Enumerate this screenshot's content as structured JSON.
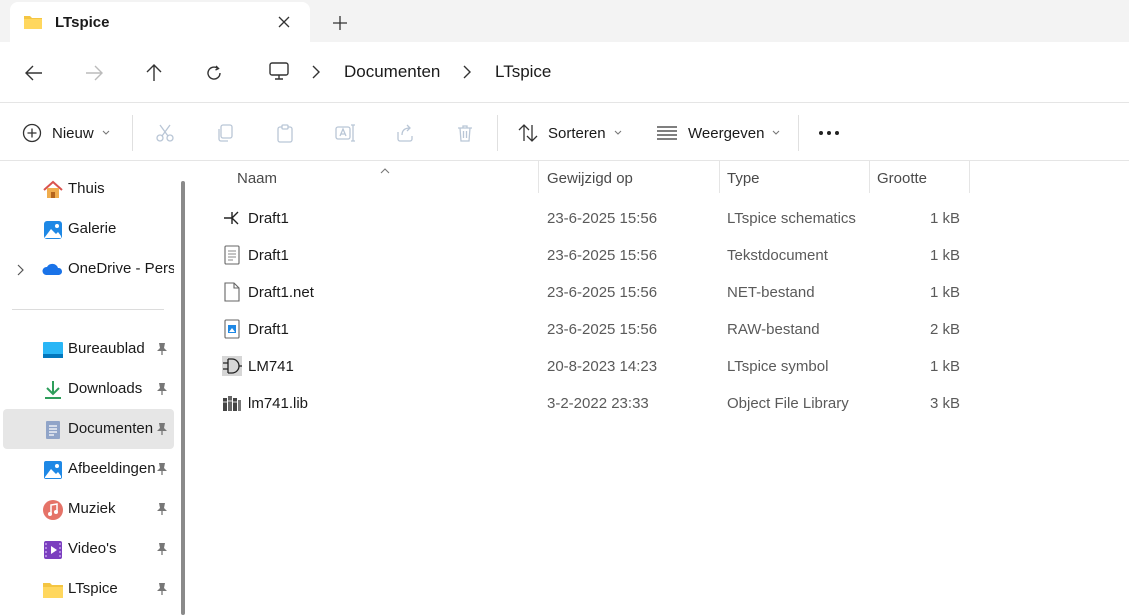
{
  "tab": {
    "title": "LTspice"
  },
  "address": {
    "crumbs": [
      "Documenten",
      "LTspice"
    ]
  },
  "commands": {
    "new_label": "Nieuw",
    "sort_label": "Sorteren",
    "view_label": "Weergeven"
  },
  "sidebar": {
    "items": [
      {
        "label": "Thuis",
        "icon": "home-icon"
      },
      {
        "label": "Galerie",
        "icon": "gallery-icon"
      },
      {
        "label": "OneDrive - Perso",
        "icon": "onedrive-icon"
      },
      {
        "label": "Bureaublad",
        "icon": "desktop-icon",
        "pinned": true
      },
      {
        "label": "Downloads",
        "icon": "download-icon",
        "pinned": true
      },
      {
        "label": "Documenten",
        "icon": "documents-icon",
        "pinned": true,
        "selected": true
      },
      {
        "label": "Afbeeldingen",
        "icon": "pictures-icon",
        "pinned": true
      },
      {
        "label": "Muziek",
        "icon": "music-icon",
        "pinned": true
      },
      {
        "label": "Video's",
        "icon": "videos-icon",
        "pinned": true
      },
      {
        "label": "LTspice",
        "icon": "folder-icon",
        "pinned": true
      }
    ]
  },
  "columns": {
    "name": "Naam",
    "modified": "Gewijzigd op",
    "type": "Type",
    "size": "Grootte"
  },
  "files": [
    {
      "name": "Draft1",
      "modified": "23-6-2025 15:56",
      "type": "LTspice schematics",
      "size": "1 kB",
      "icon": "schematic-icon"
    },
    {
      "name": "Draft1",
      "modified": "23-6-2025 15:56",
      "type": "Tekstdocument",
      "size": "1 kB",
      "icon": "text-document-icon"
    },
    {
      "name": "Draft1.net",
      "modified": "23-6-2025 15:56",
      "type": "NET-bestand",
      "size": "1 kB",
      "icon": "generic-file-icon"
    },
    {
      "name": "Draft1",
      "modified": "23-6-2025 15:56",
      "type": "RAW-bestand",
      "size": "2 kB",
      "icon": "raw-file-icon"
    },
    {
      "name": "LM741",
      "modified": "20-8-2023 14:23",
      "type": "LTspice symbol",
      "size": "1 kB",
      "icon": "symbol-icon"
    },
    {
      "name": "lm741.lib",
      "modified": "3-2-2022 23:33",
      "type": "Object File Library",
      "size": "3 kB",
      "icon": "library-icon"
    }
  ],
  "colors": {
    "accent": "#0067c0",
    "folder": "#f4c542",
    "selected_bg": "#e6e6e6"
  }
}
